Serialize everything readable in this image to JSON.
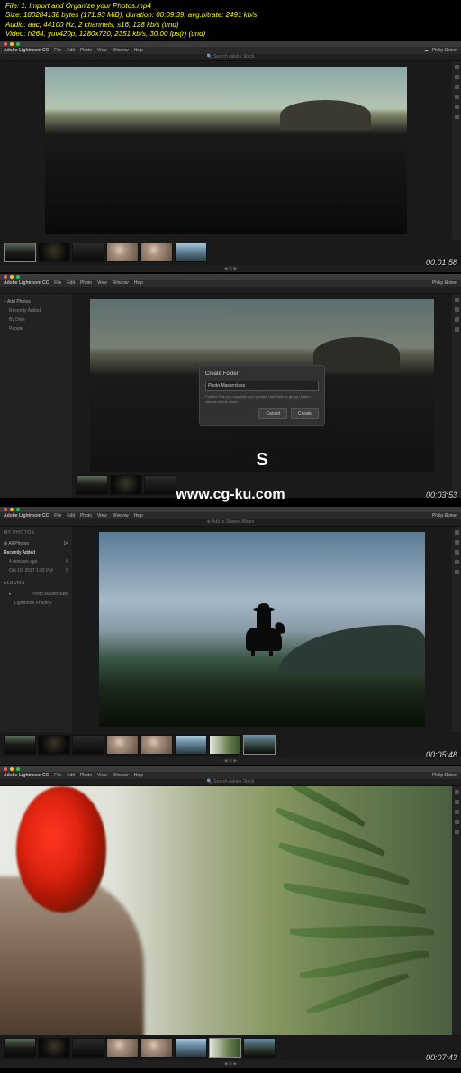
{
  "meta": {
    "line1": "File: 1. Import and Organize your Photos.mp4",
    "line2": "Size: 180284138 bytes (171.93 MiB), duration: 00:09:39, avg.bitrate: 2491 kb/s",
    "line3": "Audio: aac, 44100 Hz, 2 channels, s16, 128 kb/s (und)",
    "line4": "Video: h264, yuv420p, 1280x720, 2351 kb/s, 30.00 fps(r) (und)"
  },
  "app_name": "Adobe Lightroom CC",
  "menu": {
    "file": "File",
    "edit": "Edit",
    "photo": "Photo",
    "view": "View",
    "window": "Window",
    "help": "Help"
  },
  "user": "Philip Ebiner",
  "search_placeholder": "Search Adobe Stock",
  "panel1": {
    "timecode": "00:01:58"
  },
  "panel2": {
    "timecode": "00:03:53",
    "sidebar": {
      "add_photos": "+ Add Photos",
      "recent_label": "Recently Added",
      "by_date": "By Date",
      "people": "People"
    },
    "dialog": {
      "title": "Create Folder",
      "input_value": "Photo Masterclass",
      "hint": "Folders help you organize your photos. Use them to group related albums in one place.",
      "cancel": "Cancel",
      "create": "Create"
    },
    "big_letter": "S",
    "watermark": "www.cg-ku.com"
  },
  "panel3": {
    "timecode": "00:05:48",
    "sidebar": {
      "heading": "MY PHOTOS",
      "all": "All Photos",
      "all_count": "14",
      "recent_label": "Recently Added",
      "recent_time": "4 minutes ago",
      "recent_count": "8",
      "date": "Oct 19, 2017 1:55 PM",
      "date_count": "6",
      "albums": "ALBUMS",
      "album1": "Photo Masterclass",
      "album2": "Lightroom Practice"
    },
    "toolbar": {
      "add": "Add to Shared Album"
    }
  },
  "panel4": {
    "timecode": "00:07:43"
  }
}
